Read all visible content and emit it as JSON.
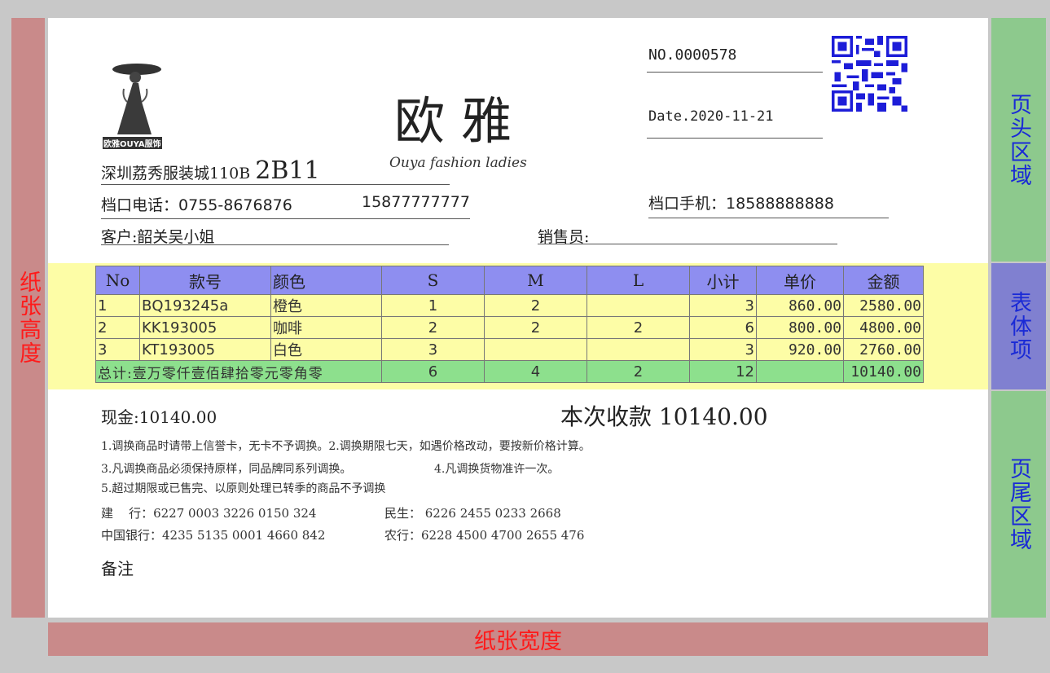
{
  "bands": {
    "paper_height": "纸张高度",
    "paper_width": "纸张宽度",
    "header_area": "页头区域",
    "body_area": "表体项",
    "footer_area": "页尾区域"
  },
  "header": {
    "logo_text": "欧雅OUYA服饰",
    "brand_cn": "欧雅",
    "brand_en": "Ouya fashion ladies",
    "shop_location": "深圳荔秀服装城110B",
    "shop_code": "2B11",
    "phone_label": "档口电话：",
    "phone": "0755-8676876",
    "phone2": "15877777777",
    "mobile_label": "档口手机：",
    "mobile": "18588888888",
    "customer_label": "客户:",
    "customer": "韶关吴小姐",
    "salesman_label": "销售员:",
    "no": "NO.0000578",
    "date": "Date.2020-11-21"
  },
  "table": {
    "columns": [
      "No",
      "款号",
      "颜色",
      "S",
      "M",
      "L",
      "小计",
      "单价",
      "金额"
    ],
    "rows": [
      {
        "no": "1",
        "code": "BQ193245a",
        "color": "橙色",
        "s": "1",
        "m": "2",
        "l": "",
        "subtotal": "3",
        "price": "860.00",
        "amount": "2580.00"
      },
      {
        "no": "2",
        "code": "KK193005",
        "color": "咖啡",
        "s": "2",
        "m": "2",
        "l": "2",
        "subtotal": "6",
        "price": "800.00",
        "amount": "4800.00"
      },
      {
        "no": "3",
        "code": "KT193005",
        "color": "白色",
        "s": "3",
        "m": "",
        "l": "",
        "subtotal": "3",
        "price": "920.00",
        "amount": "2760.00"
      }
    ],
    "total": {
      "label": "总计:壹万零仟壹佰肆拾零元零角零",
      "s": "6",
      "m": "4",
      "l": "2",
      "subtotal": "12",
      "price": "",
      "amount": "10140.00"
    }
  },
  "footer": {
    "cash": "现金:10140.00",
    "received": "本次收款  10140.00",
    "note1": "1.调换商品时请带上信誉卡，无卡不予调换。2.调换期限七天，如遇价格改动，要按新价格计算。",
    "note2": "3.凡调换商品必须保持原样，同品牌同系列调换。",
    "note2b": "4.凡调换货物准许一次。",
    "note3": "5.超过期限或已售完、以原则处理已转季的商品不予调换",
    "bank1": "建    行：6227 0003 3226 0150 324",
    "bank2": "民生： 6226 2455 0233 2668",
    "bank3": "中国银行：4235 5135 0001 4660 842",
    "bank4": "农行：6228 4500 4700 2655 476",
    "remark": "备注"
  }
}
